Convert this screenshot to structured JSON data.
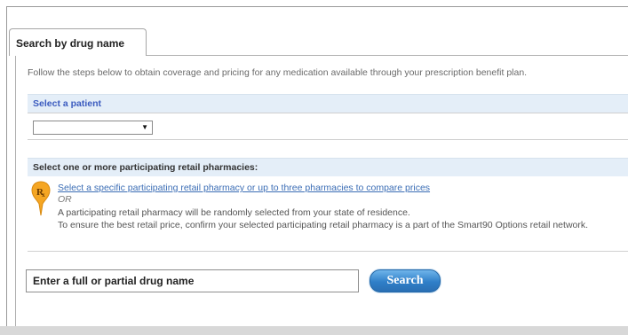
{
  "tab": {
    "label": "Search by drug name"
  },
  "intro": "Follow the steps below to obtain coverage and pricing for any medication available through your prescription benefit plan.",
  "patient_section": {
    "title": "Select a patient",
    "select_value": "",
    "arrow": "▼"
  },
  "pharmacy_section": {
    "title": "Select one or more participating retail pharmacies:",
    "icon": "rx-pin-icon",
    "link": "Select a specific participating retail pharmacy or up to three pharmacies to compare prices",
    "or": "OR",
    "random_text": "A participating retail pharmacy will be randomly selected from your state of residence.",
    "confirm_text": "To ensure the best retail price, confirm your selected participating retail pharmacy is a part of the Smart90 Options retail network."
  },
  "drug_search": {
    "placeholder": "Enter a full or partial drug name",
    "button_label": "Search"
  },
  "colors": {
    "section_bar": "#e4eef8",
    "link": "#3b6db5",
    "patient_title": "#3b5bbf",
    "pin": "#f5a623",
    "button": "#2f7fc8"
  }
}
